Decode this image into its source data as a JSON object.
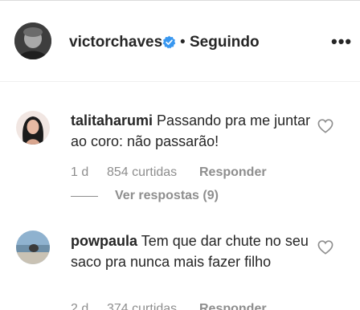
{
  "post_header": {
    "username": "victorchaves",
    "separator": "•",
    "follow_status": "Seguindo",
    "more_label": "•••"
  },
  "comments": [
    {
      "username": "talitaharumi",
      "text": "Passando pra me juntar ao coro: não passarão!",
      "age": "1 d",
      "likes": "854 curtidas",
      "reply_label": "Responder",
      "view_replies": "Ver respostas (9)"
    },
    {
      "username": "powpaula",
      "text": "Tem que dar chute no seu saco pra nunca mais fazer filho",
      "age": "2 d",
      "likes": "374 curtidas",
      "reply_label": "Responder"
    }
  ],
  "icons": {
    "verified": "verified-badge-icon",
    "heart": "heart-outline-icon",
    "more": "more-options-icon"
  },
  "colors": {
    "text": "#262626",
    "secondary": "#8e8e8e",
    "verified": "#3897f0",
    "divider": "#efefef"
  }
}
